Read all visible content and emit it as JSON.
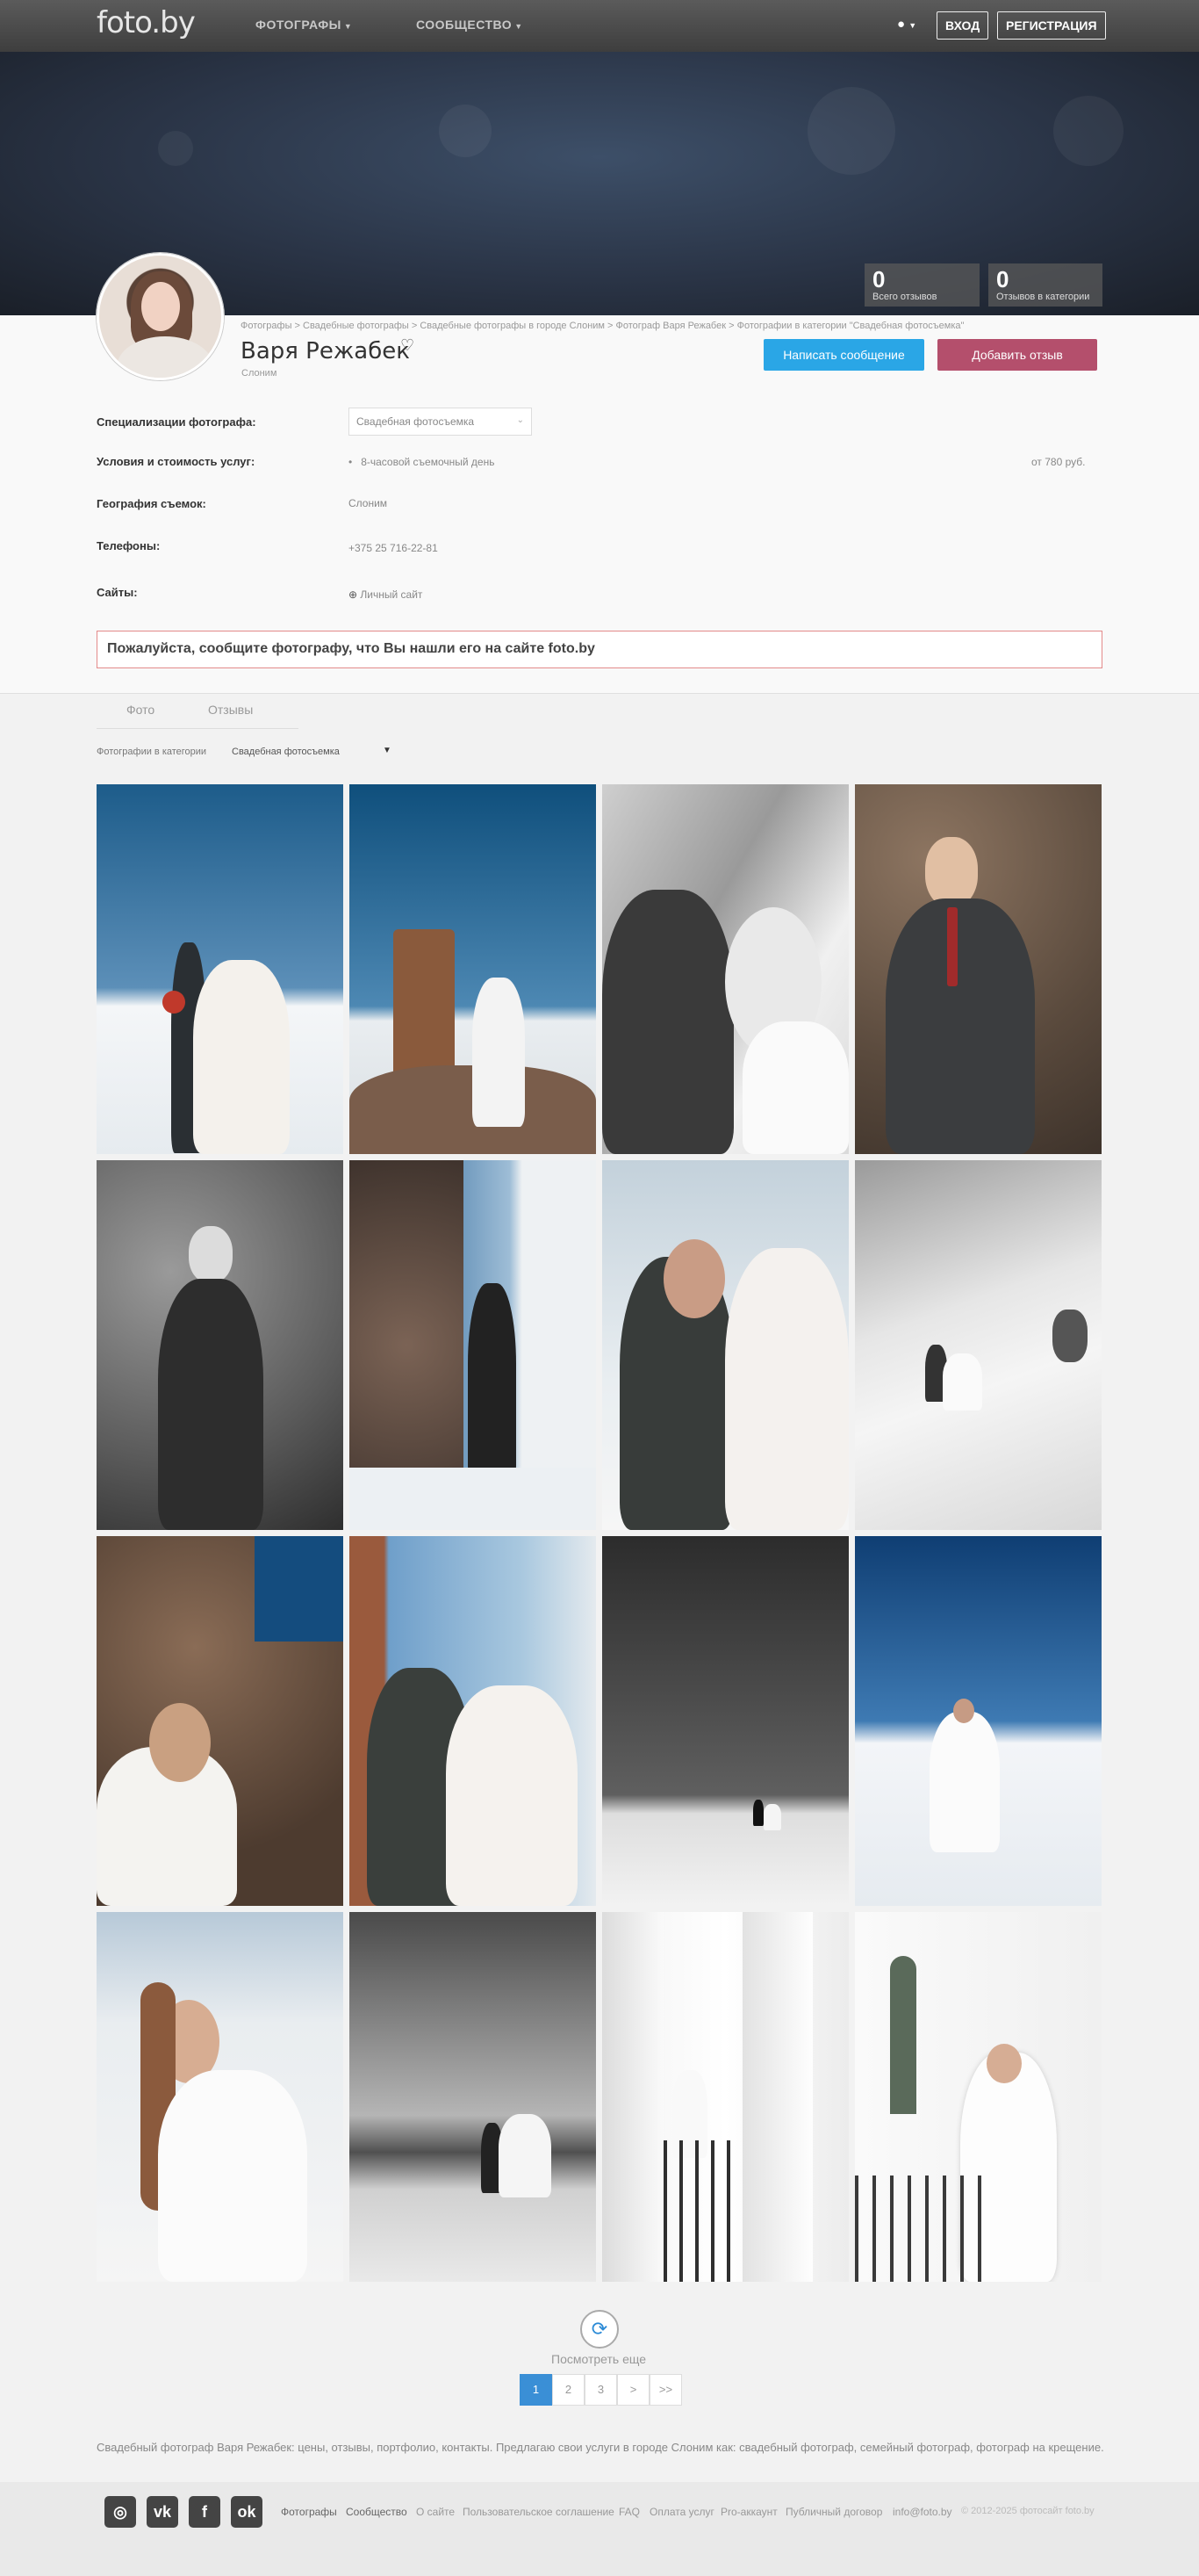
{
  "header": {
    "logo": "foto.by",
    "nav": [
      "ФОТОГРАФЫ",
      "СООБЩЕСТВО"
    ],
    "login": "ВХОД",
    "register": "РЕГИСТРАЦИЯ"
  },
  "stats": [
    {
      "value": "0",
      "label": "Всего отзывов"
    },
    {
      "value": "0",
      "label": "Отзывов в категории"
    }
  ],
  "breadcrumb": "Фотографы > Свадебные фотографы > Свадебные фотографы в городе Слоним > Фотограф Варя Режабек > Фотографии в категории \"Свадебная фотосъемка\"",
  "profile": {
    "name": "Варя Режабек",
    "city": "Слоним",
    "write_button": "Написать сообщение",
    "review_button": "Добавить отзыв"
  },
  "details": {
    "spec_label": "Специализации фотографа:",
    "spec_value": "Свадебная фотосъемка",
    "terms_label": "Условия и стоимость услуг:",
    "terms_item": "8-часовой съемочный день",
    "terms_price": "от 780 руб.",
    "geo_label": "География съемок:",
    "geo_value": "Слоним",
    "phones_label": "Телефоны:",
    "phone": "+375 25 716-22-81",
    "sites_label": "Сайты:",
    "site": "Личный сайт"
  },
  "notice": "Пожалуйста, сообщите фотографу, что Вы нашли его на сайте foto.by",
  "tabs": [
    "Фото",
    "Отзывы"
  ],
  "filter": {
    "label": "Фотографии в категории",
    "value": "Свадебная фотосъемка"
  },
  "photos": [
    {
      "alt": "wedding-couple-snow-bouquet"
    },
    {
      "alt": "couple-near-ruined-tower"
    },
    {
      "alt": "bw-bride-close-up"
    },
    {
      "alt": "groom-by-boulders"
    },
    {
      "alt": "bw-groom-stones"
    },
    {
      "alt": "groom-on-rocks-snow"
    },
    {
      "alt": "couple-kiss-hands"
    },
    {
      "alt": "bw-couple-walking-snow"
    },
    {
      "alt": "bride-lying-on-rocks"
    },
    {
      "alt": "couple-embrace-tower"
    },
    {
      "alt": "bw-couple-on-horizon"
    },
    {
      "alt": "bride-twirling-blue-sky"
    },
    {
      "alt": "bride-portrait-field"
    },
    {
      "alt": "bw-couple-dancing-field"
    },
    {
      "alt": "couple-white-columns"
    },
    {
      "alt": "bride-white-staircase"
    }
  ],
  "load_more": "Посмотреть еще",
  "pagination": [
    "1",
    "2",
    "3",
    ">",
    ">>"
  ],
  "footnote": "Свадебный фотограф Варя Режабек: цены, отзывы, портфолио, контакты. Предлагаю свои услуги в городе Слоним как: свадебный фотограф, семейный фотограф, фотограф на крещение.",
  "footer": {
    "social": [
      "instagram-icon",
      "vk-icon",
      "facebook-icon",
      "odnoklassniki-icon"
    ],
    "links": [
      "Фотографы",
      "Сообщество",
      "О сайте",
      "Пользовательское соглашение",
      "FAQ",
      "Оплата услуг",
      "Pro-аккаунт",
      "Публичный договор",
      "info@foto.by",
      "© 2012-2025 фотосайт foto.by"
    ]
  },
  "colors": {
    "primary_button": "#2aa6e6",
    "review_button": "#b44f6c",
    "active_page": "#3a8fd6",
    "notice_border": "#e38a8a"
  }
}
